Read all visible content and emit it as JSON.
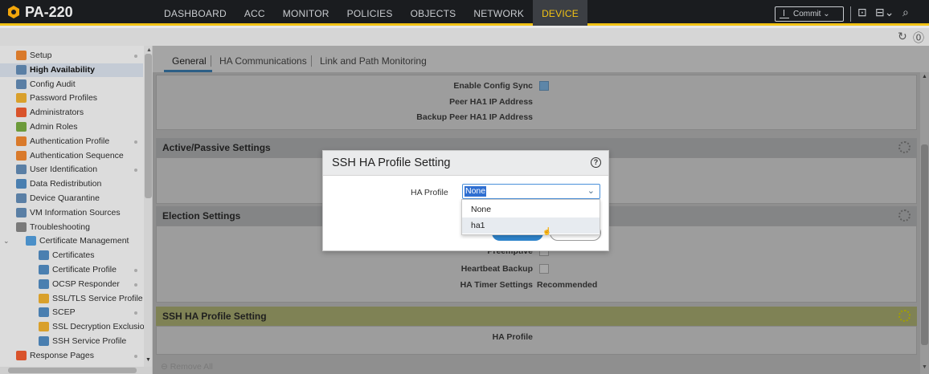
{
  "app": {
    "title": "PA-220"
  },
  "nav": {
    "tabs": [
      "DASHBOARD",
      "ACC",
      "MONITOR",
      "POLICIES",
      "OBJECTS",
      "NETWORK",
      "DEVICE"
    ],
    "active": "DEVICE",
    "commit_label": "Commit"
  },
  "sidebar": {
    "items": [
      {
        "label": "Setup",
        "icon": "setup-icon",
        "color": "#d97a2b"
      },
      {
        "label": "High Availability",
        "icon": "ha-icon",
        "color": "#5a7fa5"
      },
      {
        "label": "Config Audit",
        "icon": "audit-icon",
        "color": "#5a7fa5"
      },
      {
        "label": "Password Profiles",
        "icon": "password-icon",
        "color": "#d9a02b"
      },
      {
        "label": "Administrators",
        "icon": "admin-icon",
        "color": "#d9532b"
      },
      {
        "label": "Admin Roles",
        "icon": "roles-icon",
        "color": "#6c9a3a"
      },
      {
        "label": "Authentication Profile",
        "icon": "auth-profile-icon",
        "color": "#d97a2b"
      },
      {
        "label": "Authentication Sequence",
        "icon": "auth-seq-icon",
        "color": "#d97a2b"
      },
      {
        "label": "User Identification",
        "icon": "userid-icon",
        "color": "#5a7fa5"
      },
      {
        "label": "Data Redistribution",
        "icon": "redistribution-icon",
        "color": "#4a7fb0"
      },
      {
        "label": "Device Quarantine",
        "icon": "quarantine-icon",
        "color": "#5a7fa5"
      },
      {
        "label": "VM Information Sources",
        "icon": "vm-icon",
        "color": "#5a7fa5"
      },
      {
        "label": "Troubleshooting",
        "icon": "troubleshoot-icon",
        "color": "#7a7a7a"
      },
      {
        "label": "Certificate Management",
        "icon": "certmgmt-icon",
        "color": "#4a8fc8"
      },
      {
        "label": "Certificates",
        "icon": "certificate-icon",
        "color": "#4a7fb0"
      },
      {
        "label": "Certificate Profile",
        "icon": "cert-profile-icon",
        "color": "#4a7fb0"
      },
      {
        "label": "OCSP Responder",
        "icon": "ocsp-icon",
        "color": "#4a7fb0"
      },
      {
        "label": "SSL/TLS Service Profile",
        "icon": "lock-icon",
        "color": "#d9a02b"
      },
      {
        "label": "SCEP",
        "icon": "scep-icon",
        "color": "#4a7fb0"
      },
      {
        "label": "SSL Decryption Exclusion",
        "icon": "lock-icon",
        "color": "#d9a02b"
      },
      {
        "label": "SSH Service Profile",
        "icon": "ssh-icon",
        "color": "#4a7fb0"
      },
      {
        "label": "Response Pages",
        "icon": "response-icon",
        "color": "#d9532b"
      }
    ]
  },
  "main": {
    "tabs": [
      "General",
      "HA Communications",
      "Link and Path Monitoring"
    ],
    "active_tab": "General",
    "setup_fields": [
      {
        "label": "Enable Config Sync",
        "checked": true
      },
      {
        "label": "Peer HA1 IP Address"
      },
      {
        "label": "Backup Peer HA1 IP Address"
      }
    ],
    "active_passive": {
      "title": "Active/Passive Settings"
    },
    "election": {
      "title": "Election Settings",
      "fields": [
        {
          "label": "Preemptive",
          "checked": false
        },
        {
          "label": "Heartbeat Backup",
          "checked": false
        },
        {
          "label": "HA Timer Settings",
          "value": "Recommended"
        }
      ]
    },
    "ssh_section": {
      "title": "SSH HA Profile Setting",
      "field_label": "HA Profile"
    },
    "remove_all": "Remove All"
  },
  "modal": {
    "title": "SSH HA Profile Setting",
    "help": "?",
    "field_label": "HA Profile",
    "selected": "None",
    "options": [
      "None",
      "ha1"
    ],
    "hover_option": "ha1"
  }
}
